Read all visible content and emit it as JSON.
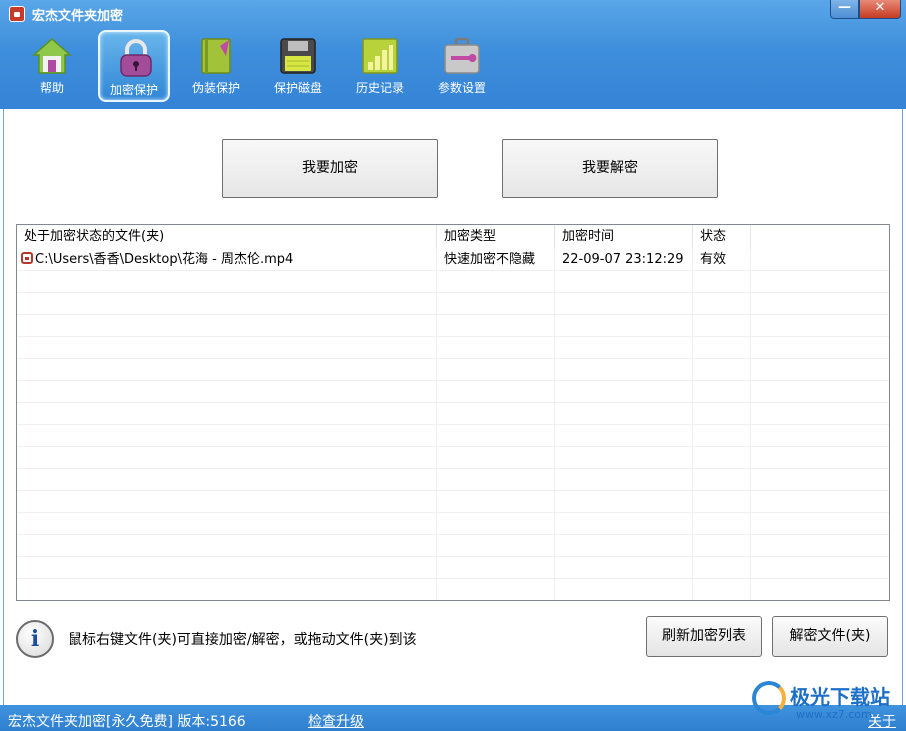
{
  "window": {
    "title": "宏杰文件夹加密",
    "minimize": "—",
    "close": "✕"
  },
  "toolbar": [
    {
      "label": "帮助",
      "icon": "house-icon",
      "active": false
    },
    {
      "label": "加密保护",
      "icon": "lock-icon",
      "active": true
    },
    {
      "label": "伪装保护",
      "icon": "notebook-icon",
      "active": false
    },
    {
      "label": "保护磁盘",
      "icon": "floppy-disk-icon",
      "active": false
    },
    {
      "label": "历史记录",
      "icon": "history-grid-icon",
      "active": false
    },
    {
      "label": "参数设置",
      "icon": "toolbox-icon",
      "active": false
    }
  ],
  "actions": {
    "encrypt": "我要加密",
    "decrypt": "我要解密"
  },
  "table": {
    "columns": [
      "处于加密状态的文件(夹)",
      "加密类型",
      "加密时间",
      "状态"
    ],
    "rows": [
      {
        "path": "C:\\Users\\香香\\Desktop\\花海 - 周杰伦.mp4",
        "type": "快速加密不隐藏",
        "time": "22-09-07 23:12:29",
        "status": "有效"
      }
    ]
  },
  "hint": "鼠标右键文件(夹)可直接加密/解密，或拖动文件(夹)到该",
  "buttons": {
    "refresh": "刷新加密列表",
    "decrypt_folder": "解密文件(夹)"
  },
  "status_bar": {
    "version": "宏杰文件夹加密[永久免费]  版本:5166",
    "check_update": "检查升级",
    "about": "关于"
  },
  "watermark": {
    "text": "极光下载站",
    "url": "www.xz7.com"
  },
  "colors": {
    "header_blue": "#3e8fdc",
    "status_blue": "#2f7fcf",
    "lock_red": "#b3372a"
  }
}
